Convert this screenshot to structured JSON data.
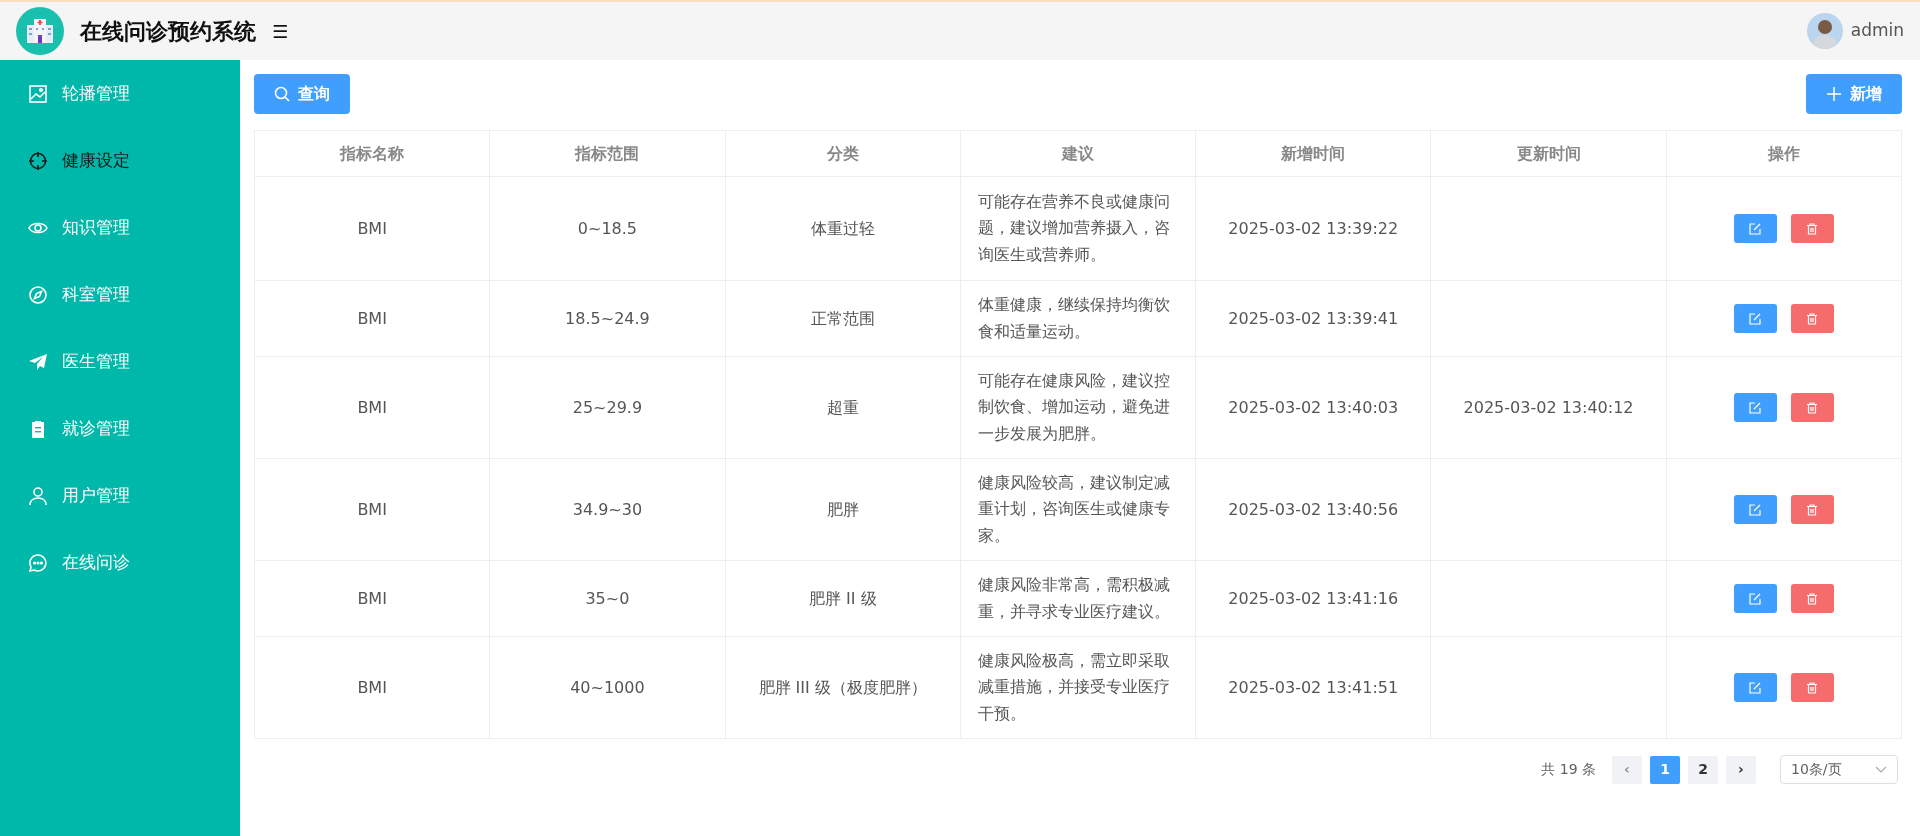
{
  "header": {
    "title": "在线问诊预约系统",
    "menu_toggle": "☰",
    "user": "admin"
  },
  "sidebar": {
    "items": [
      {
        "label": "轮播管理",
        "selected": false
      },
      {
        "label": "健康设定",
        "selected": true
      },
      {
        "label": "知识管理",
        "selected": false
      },
      {
        "label": "科室管理",
        "selected": false
      },
      {
        "label": "医生管理",
        "selected": false
      },
      {
        "label": "就诊管理",
        "selected": false
      },
      {
        "label": "用户管理",
        "selected": false
      },
      {
        "label": "在线问诊",
        "selected": false
      }
    ]
  },
  "toolbar": {
    "search_button": "查询",
    "add_button": "新增"
  },
  "table": {
    "columns": [
      "指标名称",
      "指标范围",
      "分类",
      "建议",
      "新增时间",
      "更新时间",
      "操作"
    ],
    "rows": [
      {
        "name": "BMI",
        "range": "0~18.5",
        "category": "体重过轻",
        "advice": "可能存在营养不良或健康问题，建议增加营养摄入，咨询医生或营养师。",
        "created": "2025-03-02 13:39:22",
        "updated": ""
      },
      {
        "name": "BMI",
        "range": "18.5~24.9",
        "category": "正常范围",
        "advice": "体重健康，继续保持均衡饮食和适量运动。",
        "created": "2025-03-02 13:39:41",
        "updated": ""
      },
      {
        "name": "BMI",
        "range": "25~29.9",
        "category": "超重",
        "advice": "可能存在健康风险，建议控制饮食、增加运动，避免进一步发展为肥胖。",
        "created": "2025-03-02 13:40:03",
        "updated": "2025-03-02 13:40:12"
      },
      {
        "name": "BMI",
        "range": "34.9~30",
        "category": "肥胖",
        "advice": "健康风险较高，建议制定减重计划，咨询医生或健康专家。",
        "created": "2025-03-02 13:40:56",
        "updated": ""
      },
      {
        "name": "BMI",
        "range": "35~0",
        "category": "肥胖 II 级",
        "advice": "健康风险非常高，需积极减重，并寻求专业医疗建议。",
        "created": "2025-03-02 13:41:16",
        "updated": ""
      },
      {
        "name": "BMI",
        "range": "40~1000",
        "category": "肥胖 III 级（极度肥胖）",
        "advice": "健康风险极高，需立即采取减重措施，并接受专业医疗干预。",
        "created": "2025-03-02 13:41:51",
        "updated": ""
      }
    ]
  },
  "pagination": {
    "total": "共 19 条",
    "prev": "‹",
    "pages": [
      {
        "label": "1",
        "selected": true
      },
      {
        "label": "2",
        "selected": false
      }
    ],
    "next": "›",
    "page_size": "10条/页"
  }
}
